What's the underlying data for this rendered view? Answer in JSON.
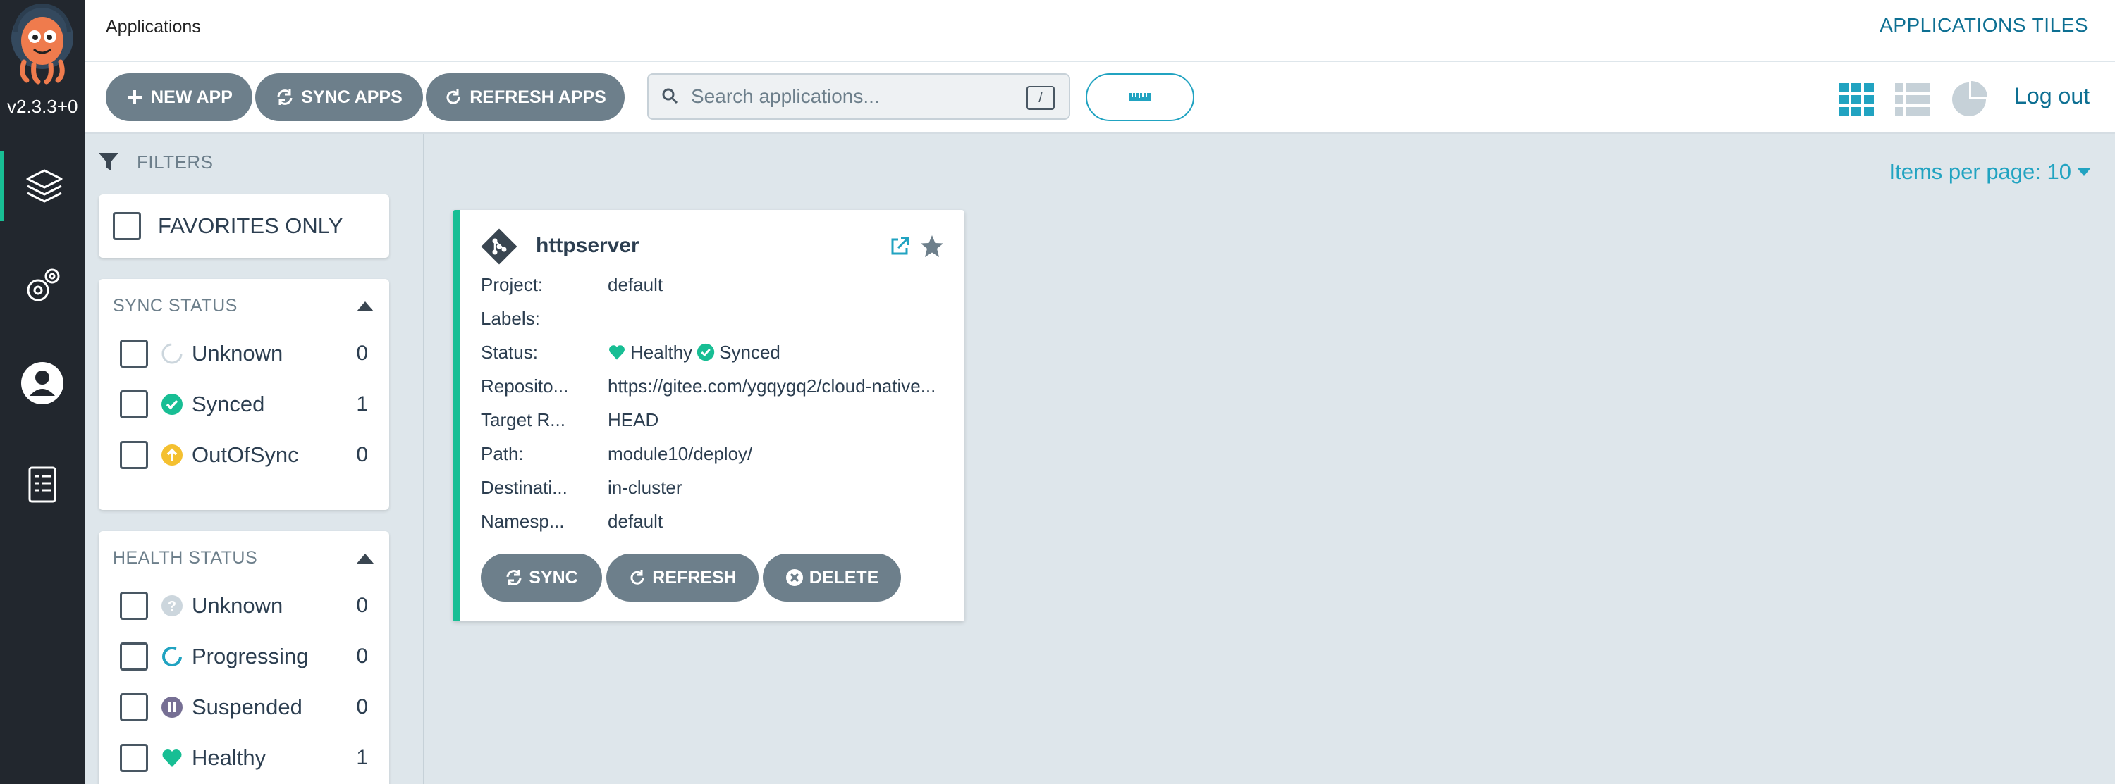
{
  "nav": {
    "version": "v2.3.3+0",
    "items": [
      "applications-icon",
      "settings-icon",
      "user-icon",
      "docs-icon"
    ]
  },
  "topbar": {
    "title": "Applications",
    "right_title": "APPLICATIONS TILES"
  },
  "toolbar": {
    "new_app": "NEW APP",
    "sync_apps": "SYNC APPS",
    "refresh_apps": "REFRESH APPS",
    "search_placeholder": "Search applications...",
    "search_shortcut": "/",
    "logout": "Log out"
  },
  "filters": {
    "header": "FILTERS",
    "favorites_label": "FAVORITES ONLY",
    "sync_status": {
      "title": "SYNC STATUS",
      "items": [
        {
          "label": "Unknown",
          "count": "0"
        },
        {
          "label": "Synced",
          "count": "1"
        },
        {
          "label": "OutOfSync",
          "count": "0"
        }
      ]
    },
    "health_status": {
      "title": "HEALTH STATUS",
      "items": [
        {
          "label": "Unknown",
          "count": "0"
        },
        {
          "label": "Progressing",
          "count": "0"
        },
        {
          "label": "Suspended",
          "count": "0"
        },
        {
          "label": "Healthy",
          "count": "1"
        }
      ]
    }
  },
  "main": {
    "items_per_page": "Items per page: 10"
  },
  "app": {
    "name": "httpserver",
    "fields": [
      {
        "label": "Project:",
        "value": "default"
      },
      {
        "label": "Labels:",
        "value": ""
      },
      {
        "label": "Status:",
        "value": ""
      },
      {
        "label": "Reposito...",
        "value": "https://gitee.com/ygqygq2/cloud-native..."
      },
      {
        "label": "Target R...",
        "value": "HEAD"
      },
      {
        "label": "Path:",
        "value": "module10/deploy/"
      },
      {
        "label": "Destinati...",
        "value": "in-cluster"
      },
      {
        "label": "Namesp...",
        "value": "default"
      }
    ],
    "health": "Healthy",
    "sync": "Synced",
    "buttons": {
      "sync": "SYNC",
      "refresh": "REFRESH",
      "delete": "DELETE"
    }
  },
  "colors": {
    "accent": "#21a3c1",
    "healthy": "#18be94",
    "out_of_sync": "#f4c030",
    "suspended": "#766f94",
    "button_gray": "#6d7f8b",
    "nav_bg": "#22272e"
  }
}
